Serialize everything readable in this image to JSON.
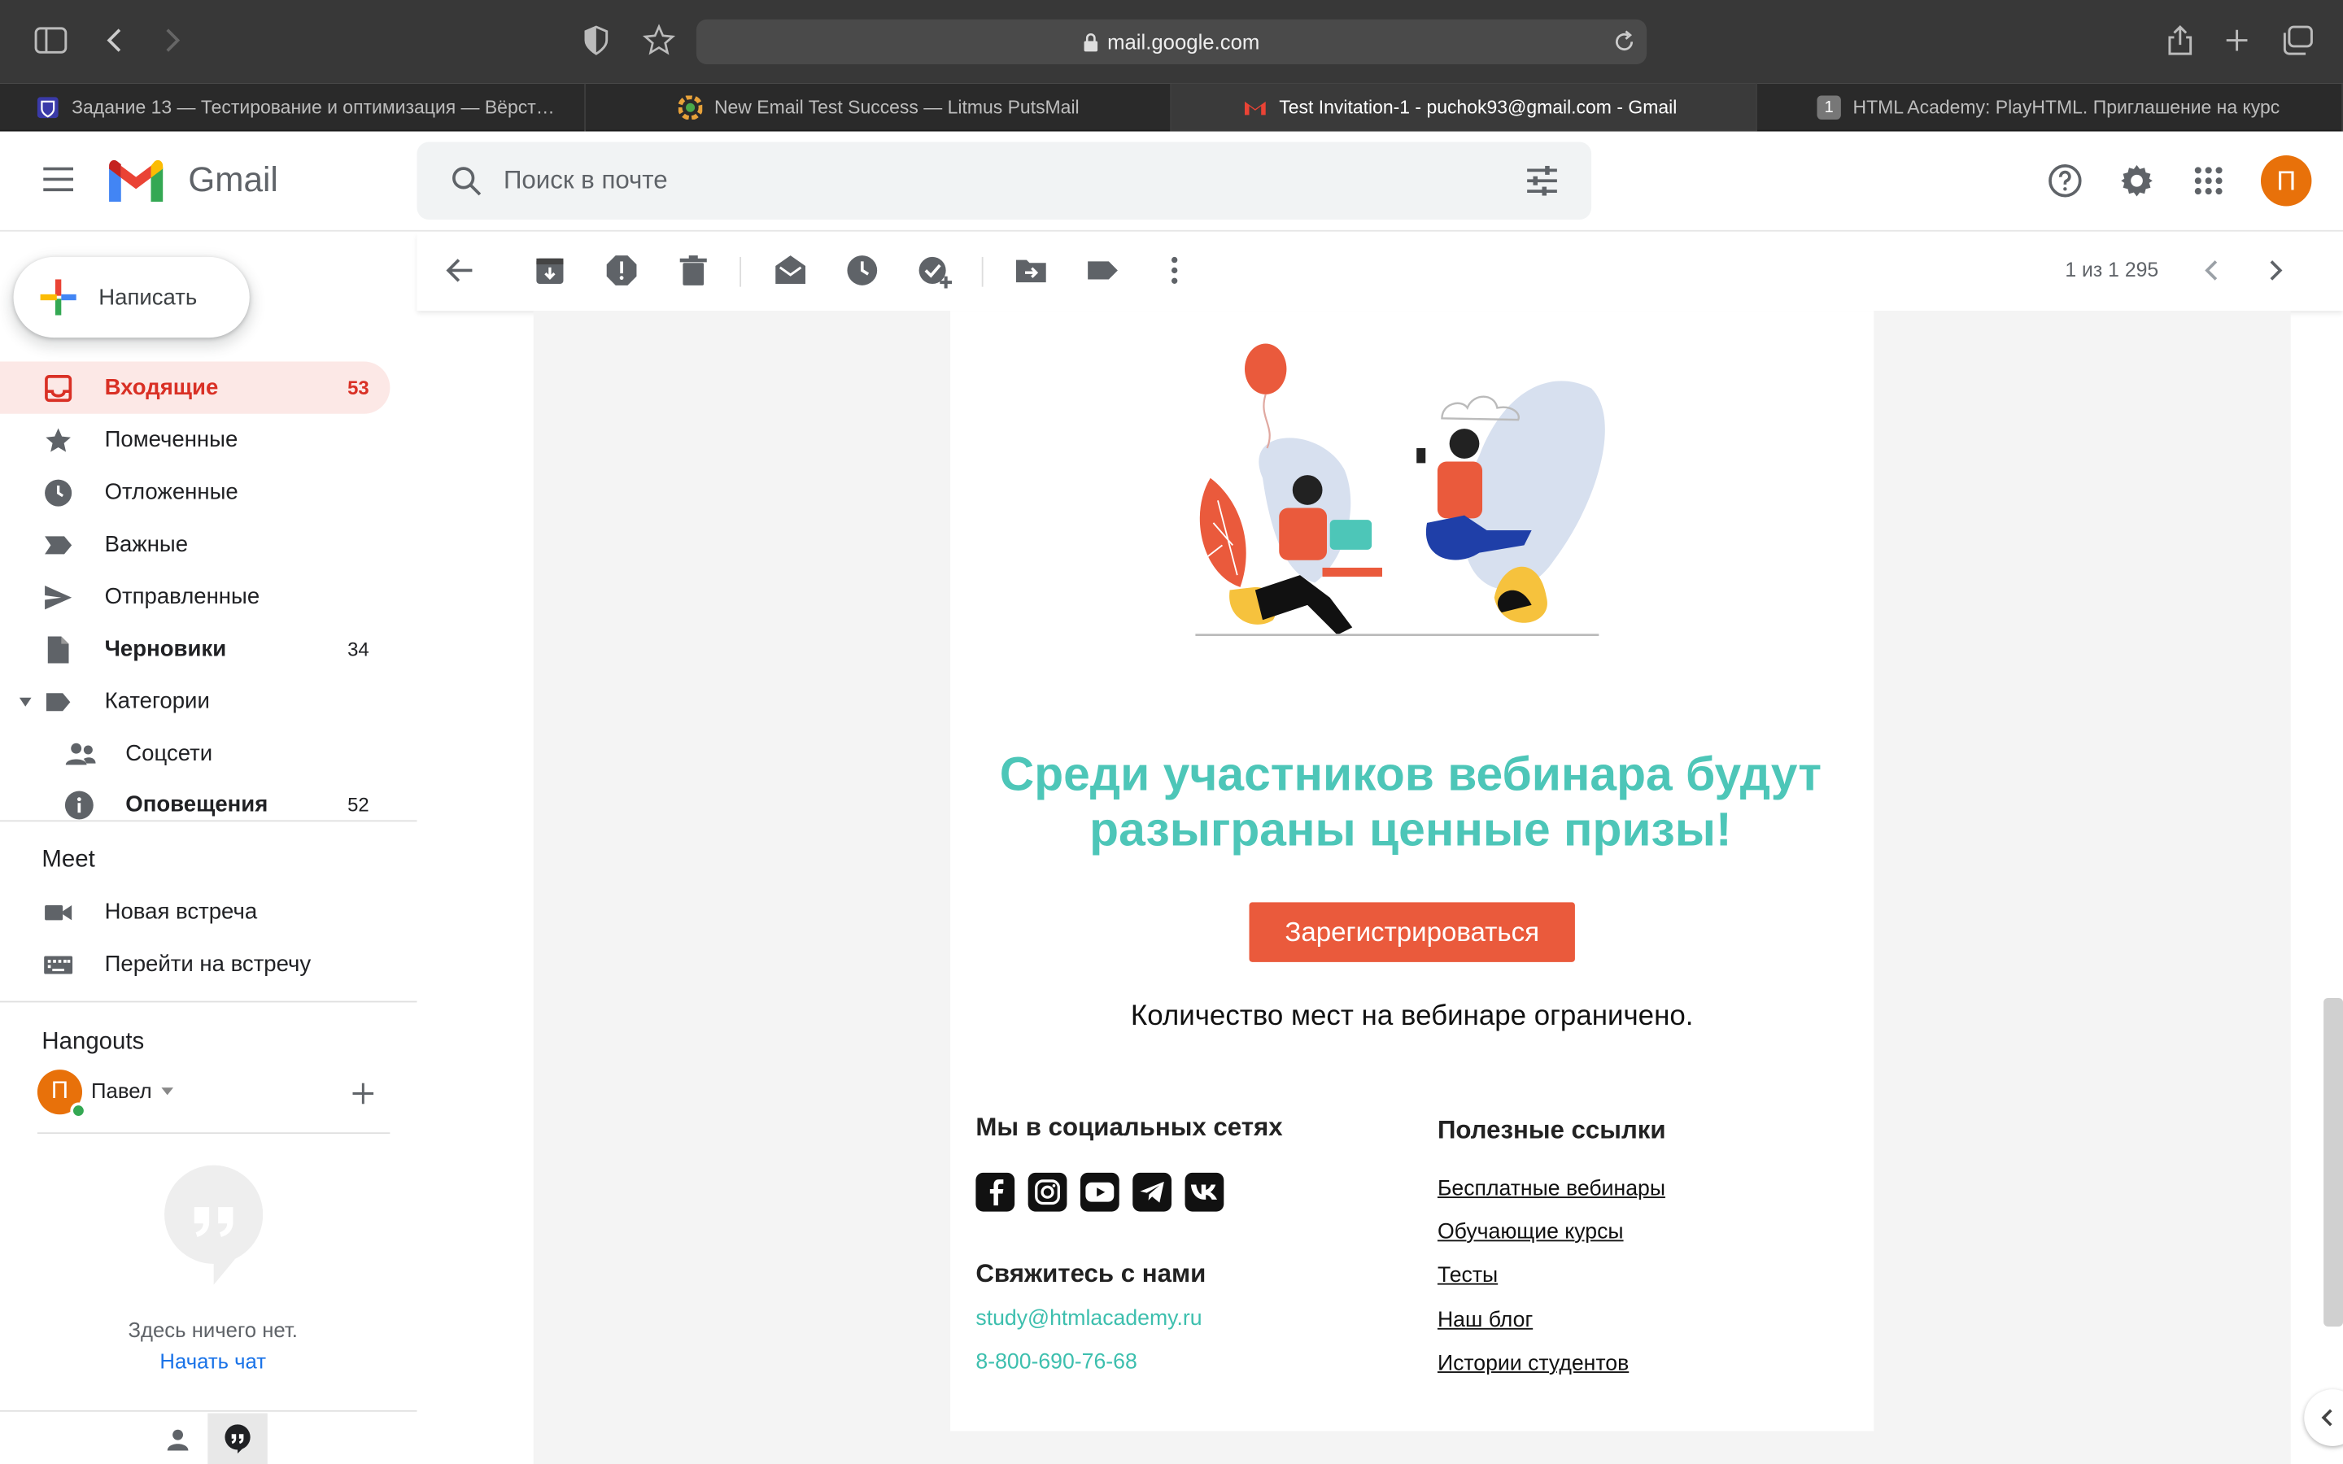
{
  "browser": {
    "url": "mail.google.com",
    "tabs": [
      {
        "title": "Задание 13 — Тестирование и оптимизация — Вёрст…",
        "active": false
      },
      {
        "title": "New Email Test Success — Litmus PutsMail",
        "active": false
      },
      {
        "title": "Test Invitation-1 - puchok93@gmail.com - Gmail",
        "active": true
      },
      {
        "title": "HTML Academy: PlayHTML. Приглашение на курс",
        "active": false
      }
    ],
    "tab4_badge": "1"
  },
  "gmail": {
    "brand": "Gmail",
    "search_placeholder": "Поиск в почте",
    "avatar_letter": "П",
    "compose_label": "Написать",
    "nav": [
      {
        "label": "Входящие",
        "count": "53",
        "icon": "inbox-icon"
      },
      {
        "label": "Помеченные",
        "count": "",
        "icon": "star-icon"
      },
      {
        "label": "Отложенные",
        "count": "",
        "icon": "clock-icon"
      },
      {
        "label": "Важные",
        "count": "",
        "icon": "important-icon"
      },
      {
        "label": "Отправленные",
        "count": "",
        "icon": "send-icon"
      },
      {
        "label": "Черновики",
        "count": "34",
        "icon": "draft-icon"
      },
      {
        "label": "Категории",
        "count": "",
        "icon": "label-icon"
      },
      {
        "label": "Соцсети",
        "count": "",
        "icon": "people-icon"
      },
      {
        "label": "Оповещения",
        "count": "52",
        "icon": "info-icon"
      }
    ],
    "meet": {
      "title": "Meet",
      "new_meeting": "Новая встреча",
      "join_meeting": "Перейти на встречу"
    },
    "hangouts": {
      "title": "Hangouts",
      "user": "Павел",
      "avatar_letter": "П",
      "empty_text": "Здесь ничего нет.",
      "start_chat": "Начать чат"
    },
    "pagination": "1 из 1 295"
  },
  "email": {
    "headline": "Среди участников вебинара будут разыграны ценные призы!",
    "register_button": "Зарегистрироваться",
    "limited_text": "Количество мест на вебинаре ограничено.",
    "social_title": "Мы в социальных сетях",
    "social_icons": [
      "facebook-icon",
      "instagram-icon",
      "youtube-icon",
      "telegram-icon",
      "vk-icon"
    ],
    "contact_title": "Свяжитесь с нами",
    "contact_email": "study@htmlacademy.ru",
    "contact_phone": "8-800-690-76-68",
    "links_title": "Полезные ссылки",
    "links": [
      "Бесплатные вебинары",
      "Обучающие курсы",
      "Тесты",
      "Наш блог",
      "Истории студентов"
    ],
    "colors": {
      "headline": "#4dc6b8",
      "button": "#ea5a3c"
    }
  }
}
